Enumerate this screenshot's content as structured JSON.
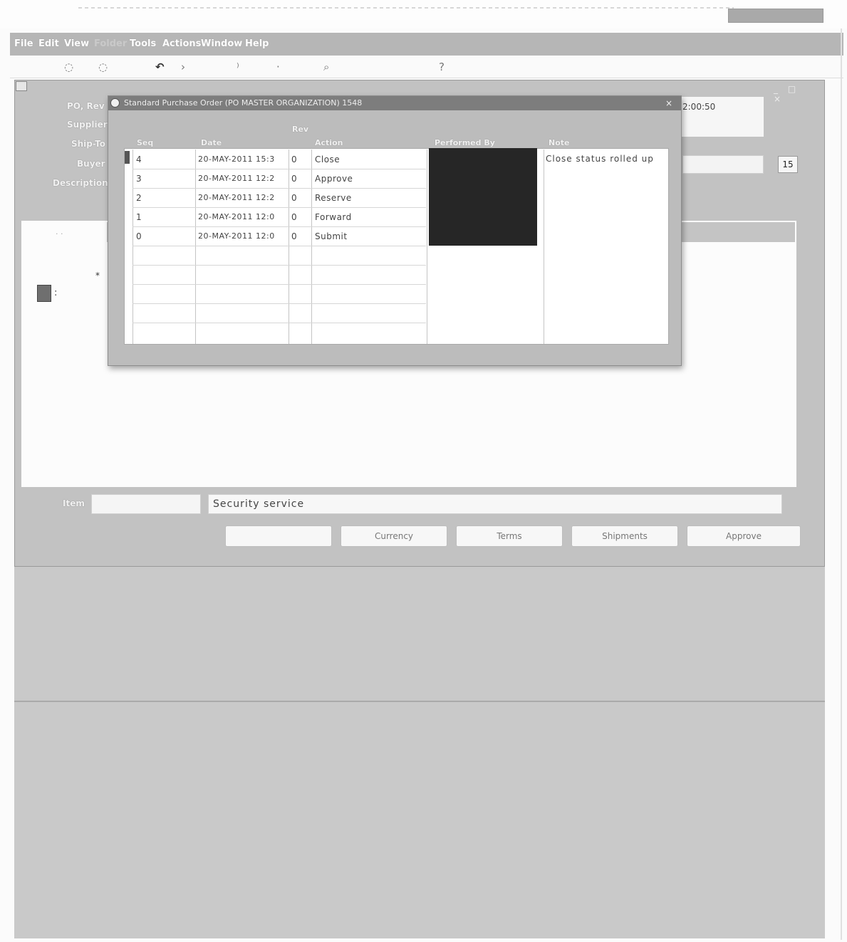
{
  "menubar": {
    "items": [
      "File",
      "Edit",
      "View",
      "Folder",
      "Tools",
      "Actions",
      "Window",
      "Help"
    ]
  },
  "toolbar": {
    "icons": [
      "open-icon",
      "save-icon",
      "undo-icon",
      "cut-icon",
      "copy-icon",
      "paste-icon",
      "find-icon",
      "help-icon"
    ],
    "help_glyph": "?"
  },
  "po_header": {
    "labels": [
      "PO, Rev",
      "Supplier",
      "Ship-To",
      "Buyer",
      "Description"
    ],
    "created_time": "2:00:50",
    "window_controls": "_ □ ×",
    "small_button": "15"
  },
  "modal": {
    "title": "Standard Purchase Order (PO MASTER ORGANIZATION) 1548",
    "close_glyph": "×",
    "columns": {
      "seq": "Seq",
      "date": "Date",
      "rev": "Rev",
      "action": "Action",
      "performed_by": "Performed By",
      "note": "Note"
    },
    "rows": [
      {
        "seq": "4",
        "date": "20-MAY-2011 15:3",
        "rev": "0",
        "action": "Close"
      },
      {
        "seq": "3",
        "date": "20-MAY-2011 12:2",
        "rev": "0",
        "action": "Approve"
      },
      {
        "seq": "2",
        "date": "20-MAY-2011 12:2",
        "rev": "0",
        "action": "Reserve"
      },
      {
        "seq": "1",
        "date": "20-MAY-2011 12:0",
        "rev": "0",
        "action": "Forward"
      },
      {
        "seq": "0",
        "date": "20-MAY-2011 12:0",
        "rev": "0",
        "action": "Submit"
      }
    ],
    "note_value": "Close status rolled up"
  },
  "item_row": {
    "label": "Item",
    "description": "Security service"
  },
  "buttons": [
    "",
    "Currency",
    "Terms",
    "Shipments",
    "Approve"
  ]
}
